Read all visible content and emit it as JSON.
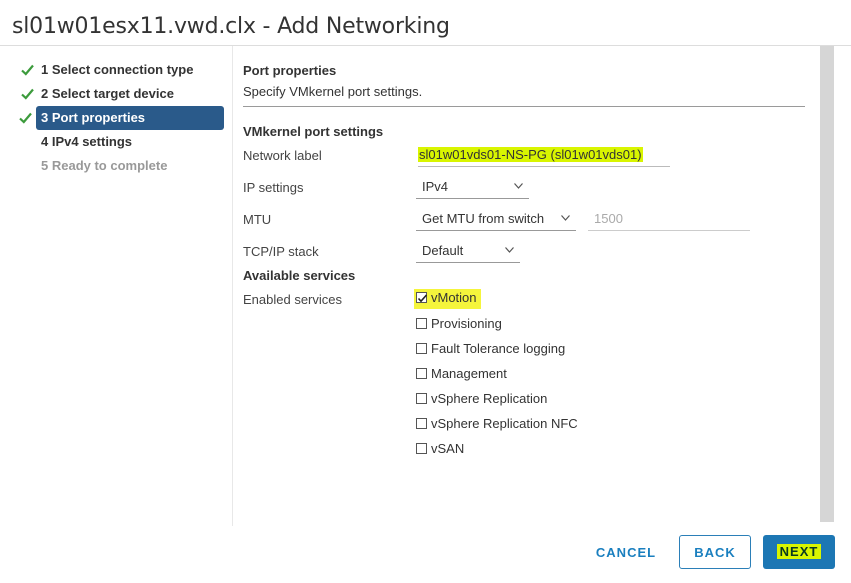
{
  "window": {
    "title": "sl01w01esx11.vwd.clx - Add Networking"
  },
  "steps": [
    {
      "label": "1 Select connection type",
      "state": "complete"
    },
    {
      "label": "2 Select target device",
      "state": "complete"
    },
    {
      "label": "3 Port properties",
      "state": "active"
    },
    {
      "label": "4 IPv4 settings",
      "state": "pending"
    },
    {
      "label": "5 Ready to complete",
      "state": "disabled"
    }
  ],
  "header": {
    "title": "Port properties",
    "description": "Specify VMkernel port settings."
  },
  "vmk": {
    "section_title": "VMkernel port settings",
    "network_label": {
      "label": "Network label",
      "value": "sl01w01vds01-NS-PG (sl01w01vds01)"
    },
    "ip_settings": {
      "label": "IP settings",
      "value": "IPv4"
    },
    "mtu": {
      "label": "MTU",
      "value": "Get MTU from switch",
      "input_value": "1500"
    },
    "tcpip": {
      "label": "TCP/IP stack",
      "value": "Default"
    }
  },
  "services": {
    "section_title": "Available services",
    "label": "Enabled services",
    "items": [
      {
        "label": "vMotion",
        "checked": true
      },
      {
        "label": "Provisioning",
        "checked": false
      },
      {
        "label": "Fault Tolerance logging",
        "checked": false
      },
      {
        "label": "Management",
        "checked": false
      },
      {
        "label": "vSphere Replication",
        "checked": false
      },
      {
        "label": "vSphere Replication NFC",
        "checked": false
      },
      {
        "label": "vSAN",
        "checked": false
      }
    ]
  },
  "footer": {
    "cancel_label": "CANCEL",
    "back_label": "BACK",
    "next_label": "NEXT"
  },
  "colors": {
    "highlight": "#d9f500",
    "accent": "#1d77b4",
    "active_step": "#2a5a8a",
    "check": "#3c9b3c"
  }
}
